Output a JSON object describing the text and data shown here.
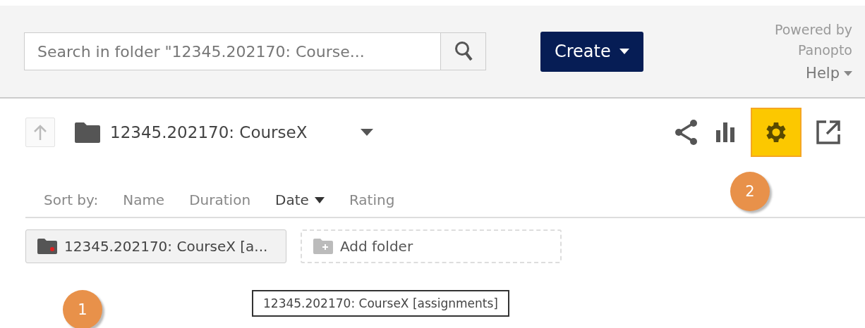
{
  "header": {
    "search": {
      "placeholder": "Search in folder \"12345.202170: Course..."
    },
    "create_button": "Create",
    "powered_by": "Powered by",
    "brand": "Panopto",
    "help": "Help"
  },
  "folder": {
    "title": "12345.202170: CourseX",
    "toolbar": [
      {
        "kind": "share",
        "highlighted": false
      },
      {
        "kind": "stats",
        "highlighted": false
      },
      {
        "kind": "settings",
        "highlighted": true
      },
      {
        "kind": "external",
        "highlighted": false
      }
    ]
  },
  "sort": {
    "label": "Sort by:",
    "options": [
      {
        "label": "Name",
        "selected": false
      },
      {
        "label": "Duration",
        "selected": false
      },
      {
        "label": "Date",
        "selected": true
      },
      {
        "label": "Rating",
        "selected": false
      }
    ]
  },
  "subfolders": [
    {
      "kind": "folder",
      "label": "12345.202170: CourseX [a..."
    },
    {
      "kind": "add",
      "label": "Add folder"
    }
  ],
  "tooltip": "12345.202170: CourseX [assignments]",
  "callouts": [
    "1",
    "2"
  ]
}
